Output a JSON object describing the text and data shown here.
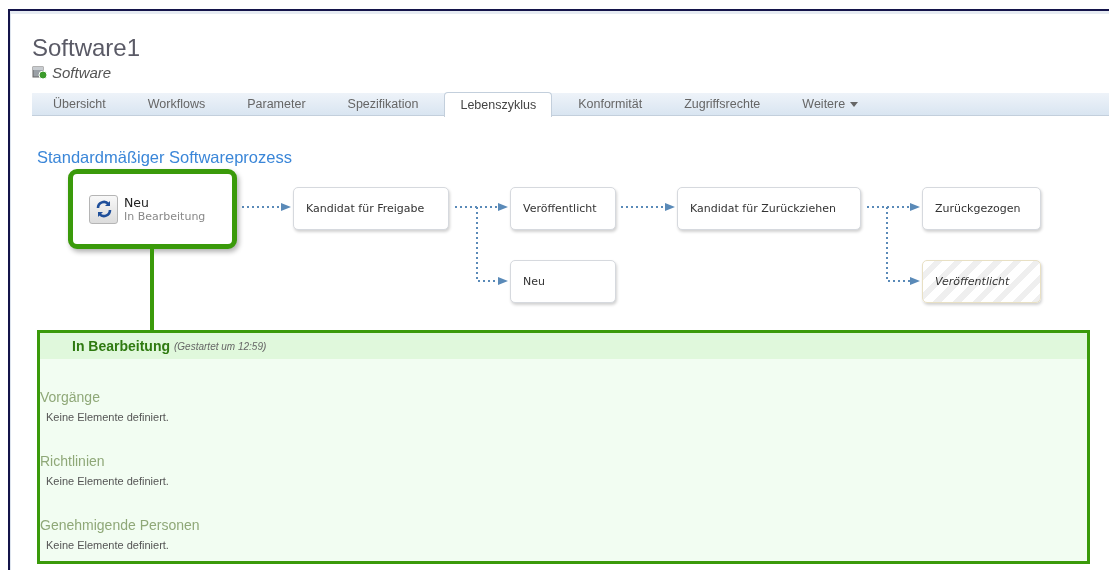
{
  "page": {
    "title": "Software1",
    "subtitle": "Software"
  },
  "tabs": [
    {
      "label": "Übersicht",
      "selected": false,
      "dropdown": false
    },
    {
      "label": "Workflows",
      "selected": false,
      "dropdown": false
    },
    {
      "label": "Parameter",
      "selected": false,
      "dropdown": false
    },
    {
      "label": "Spezifikation",
      "selected": false,
      "dropdown": false
    },
    {
      "label": "Lebenszyklus",
      "selected": true,
      "dropdown": false
    },
    {
      "label": "Konformität",
      "selected": false,
      "dropdown": false
    },
    {
      "label": "Zugriffsrechte",
      "selected": false,
      "dropdown": false
    },
    {
      "label": "Weitere",
      "selected": false,
      "dropdown": true
    }
  ],
  "process": {
    "title": "Standardmäßiger Softwareprozess",
    "current": {
      "name": "Neu",
      "status": "In Bearbeitung"
    },
    "states": [
      {
        "label": "Kandidat für Freigabe",
        "kind": "normal"
      },
      {
        "label": "Veröffentlicht",
        "kind": "normal"
      },
      {
        "label": "Kandidat für Zurückziehen",
        "kind": "normal"
      },
      {
        "label": "Zurückgezogen",
        "kind": "normal"
      },
      {
        "label": "Neu",
        "kind": "normal"
      },
      {
        "label": "Veröffentlicht",
        "kind": "ghost"
      }
    ]
  },
  "detail": {
    "title": "In Bearbeitung",
    "note": "(Gestartet um 12:59)",
    "sections": [
      {
        "heading": "Vorgänge",
        "text": "Keine Elemente definiert."
      },
      {
        "heading": "Richtlinien",
        "text": "Keine Elemente definiert."
      },
      {
        "heading": "Genehmigende Personen",
        "text": "Keine Elemente definiert."
      }
    ]
  }
}
